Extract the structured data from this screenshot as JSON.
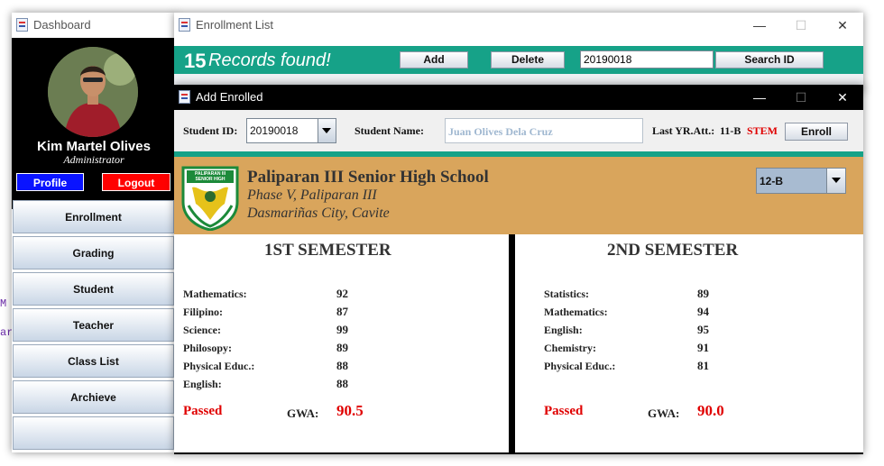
{
  "dashboard": {
    "title": "Dashboard",
    "user_name": "Kim Martel Olives",
    "user_role": "Administrator",
    "profile_label": "Profile",
    "logout_label": "Logout",
    "nav": [
      "Enrollment",
      "Grading",
      "Student",
      "Teacher",
      "Class List",
      "Archieve"
    ],
    "colors": {
      "sidebar_bg": "#000000",
      "profile_btn": "#0a14ff",
      "logout_btn": "#ff0000"
    }
  },
  "enrollment_list": {
    "title": "Enrollment List",
    "count": "15",
    "records_text": "Records found!",
    "add_label": "Add",
    "delete_label": "Delete",
    "search_value": "20190018",
    "search_button_label": "Search ID",
    "colors": {
      "header_bg": "#16a288"
    }
  },
  "add_enrolled": {
    "title": "Add Enrolled",
    "student_id_label": "Student ID:",
    "student_id_value": "20190018",
    "student_name_label": "Student Name:",
    "student_name_value": "Juan Olives Dela Cruz",
    "last_yr_label": "Last YR.Att.:",
    "last_yr_value": "11-B",
    "last_yr_strand": "STEM",
    "enroll_label": "Enroll",
    "school": {
      "name": "Paliparan III Senior High School",
      "address1": "Phase V, Paliparan III",
      "address2": "Dasmariñas City, Cavite",
      "logo_text": "PALIPARAN III SENIOR HIGH SCHOOL"
    },
    "section_value": "12-B",
    "first_sem": {
      "title": "1ST SEMESTER",
      "subjects": [
        {
          "name": "Mathematics:",
          "grade": "92"
        },
        {
          "name": "Filipino:",
          "grade": "87"
        },
        {
          "name": "Science:",
          "grade": "99"
        },
        {
          "name": "Philosopy:",
          "grade": "89"
        },
        {
          "name": "Physical Educ.:",
          "grade": "88"
        },
        {
          "name": "English:",
          "grade": "88"
        }
      ],
      "status": "Passed",
      "gwa_label": "GWA:",
      "gwa_value": "90.5"
    },
    "second_sem": {
      "title": "2ND SEMESTER",
      "subjects": [
        {
          "name": "Statistics:",
          "grade": "89"
        },
        {
          "name": "Mathematics:",
          "grade": "94"
        },
        {
          "name": "English:",
          "grade": "95"
        },
        {
          "name": "Chemistry:",
          "grade": "91"
        },
        {
          "name": "Physical Educ.:",
          "grade": "81"
        }
      ],
      "status": "Passed",
      "gwa_label": "GWA:",
      "gwa_value": "90.0"
    },
    "colors": {
      "school_band": "#d9a55c",
      "accent_green": "#16a288",
      "status_red": "#e00000"
    }
  },
  "background_glyphs": [
    "M",
    "ar"
  ]
}
